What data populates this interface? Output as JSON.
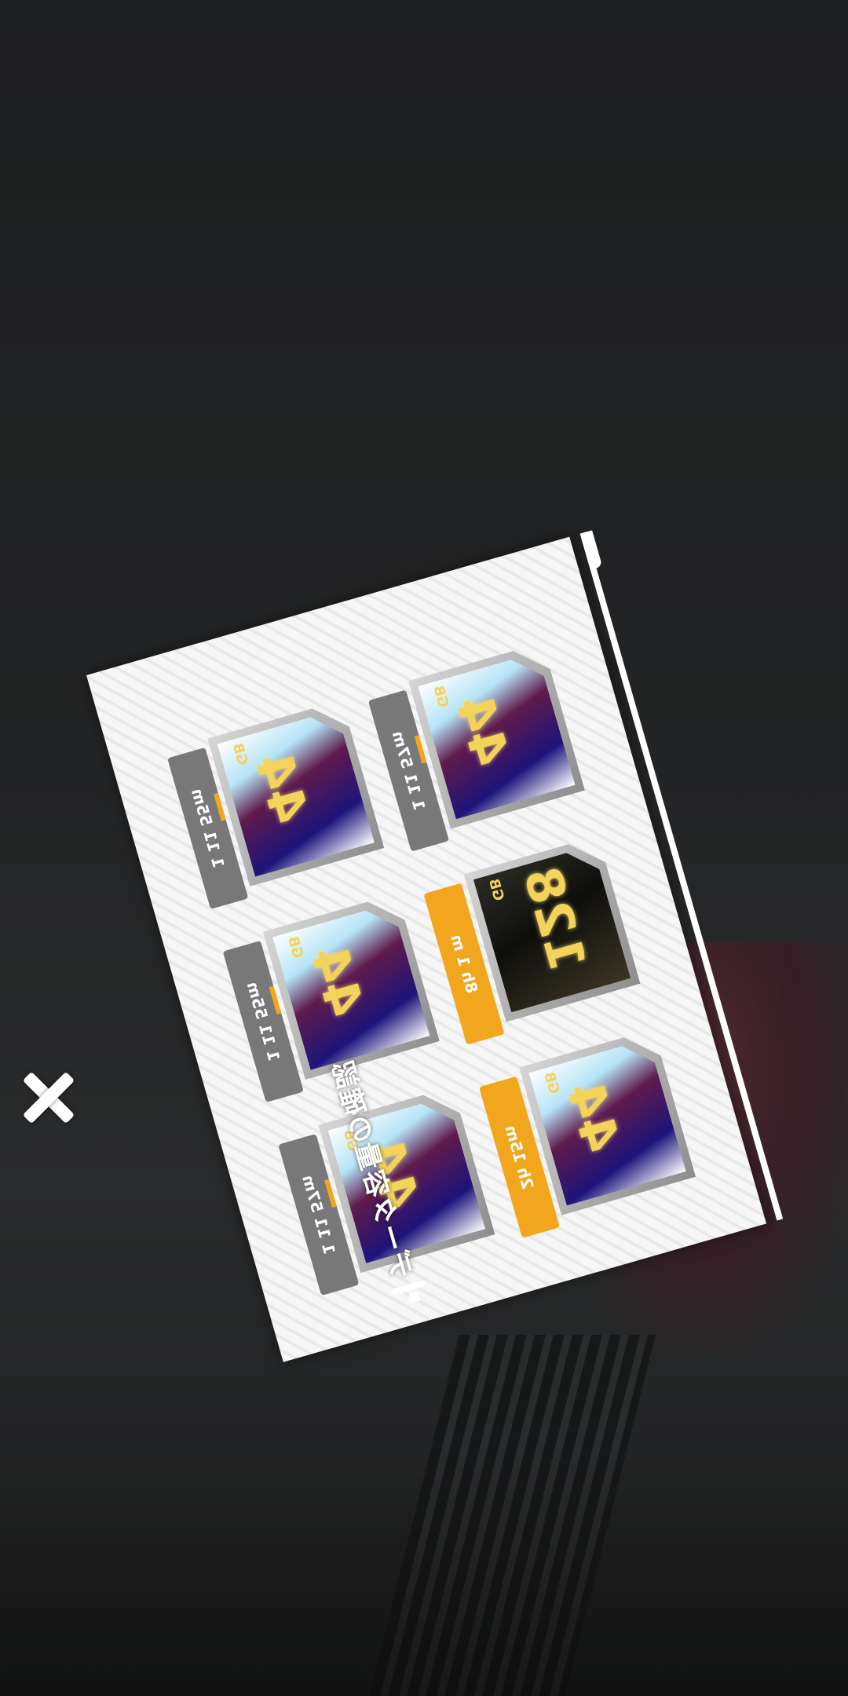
{
  "popup": {
    "title": "データ容量の確認",
    "cards": [
      {
        "label": "1 11 55m",
        "value": "44",
        "unit": "GB",
        "dark": false,
        "highlight": false
      },
      {
        "label": "1 11 57m",
        "value": "44",
        "unit": "GB",
        "dark": false,
        "highlight": false
      },
      {
        "label": "1 11 55m",
        "value": "44",
        "unit": "GB",
        "dark": false,
        "highlight": false
      },
      {
        "label": "8h 1 m",
        "value": "128",
        "unit": "GB",
        "dark": true,
        "highlight": true
      },
      {
        "label": "1 11 57m",
        "value": "44",
        "unit": "GB",
        "dark": false,
        "highlight": false
      },
      {
        "label": "2h 15m",
        "value": "44",
        "unit": "GB",
        "dark": false,
        "highlight": true
      }
    ]
  },
  "close_icon": "close-icon"
}
